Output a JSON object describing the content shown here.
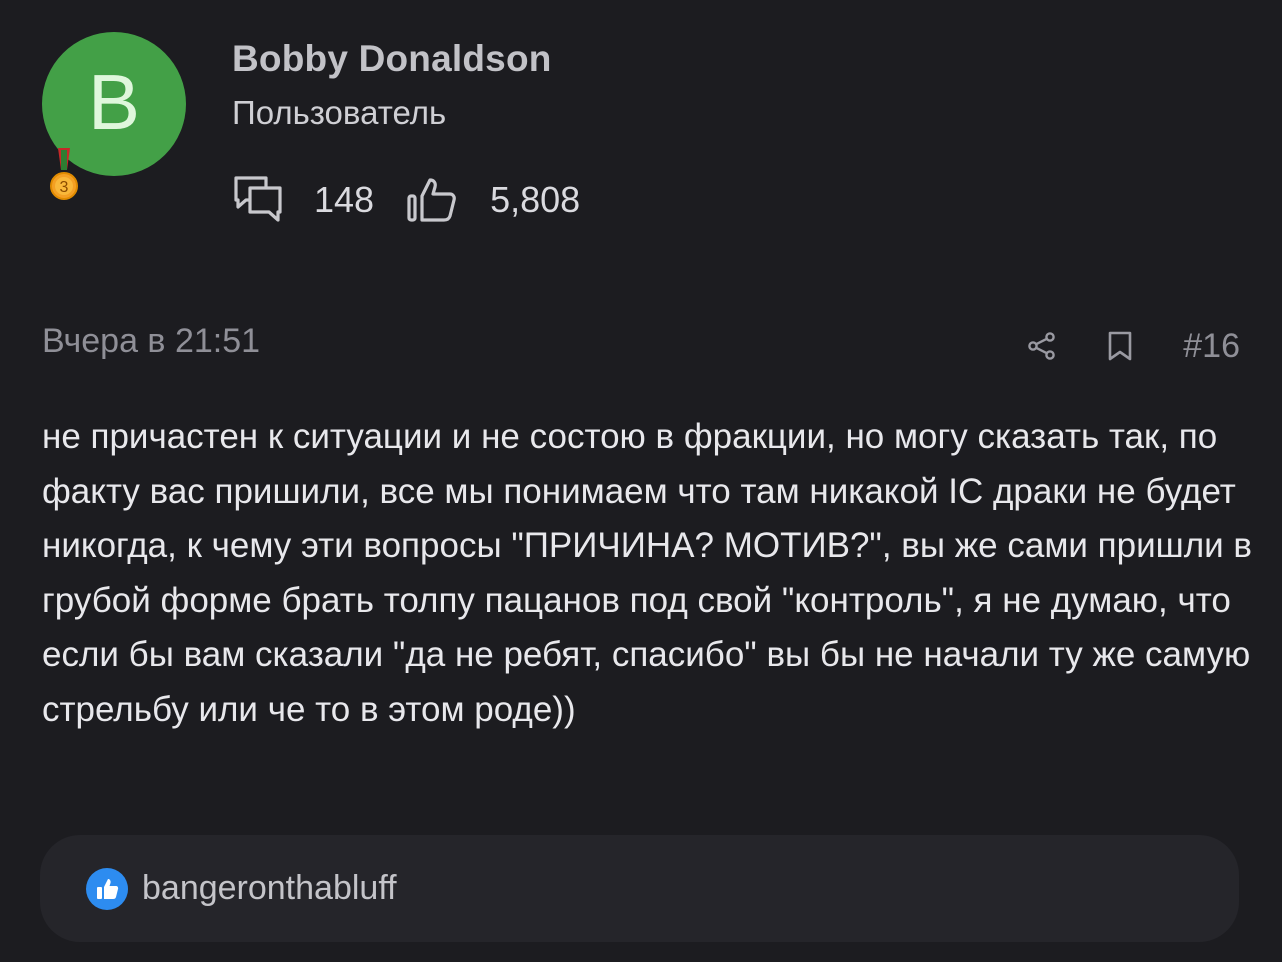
{
  "author": {
    "avatar_letter": "B",
    "avatar_color": "#43a047",
    "name": "Bobby Donaldson",
    "role": "Пользователь",
    "medal_level": "3",
    "messages_icon": "messages-icon",
    "messages_count": "148",
    "likes_icon": "thumbs-up-icon",
    "likes_count": "5,808"
  },
  "post": {
    "date": "Вчера в 21:51",
    "share_icon": "share-icon",
    "bookmark_icon": "bookmark-icon",
    "number": "#16",
    "body": "не причастен к ситуации и не состою в фракции, но могу сказать так, по факту вас пришили, все мы понимаем что там никакой IC драки не будет никогда, к чему эти вопросы \"ПРИЧИНА? МОТИВ?\", вы же сами пришли в грубой форме брать толпу пацанов под свой \"контроль\", я не думаю, что если бы вам сказали \"да не ребят, спасибо\" вы бы не начали ту же самую стрельбу или че то в этом роде))"
  },
  "reactions": {
    "icon": "like-reaction-icon",
    "color": "#2d8cf0",
    "user": "bangeronthabluff"
  }
}
